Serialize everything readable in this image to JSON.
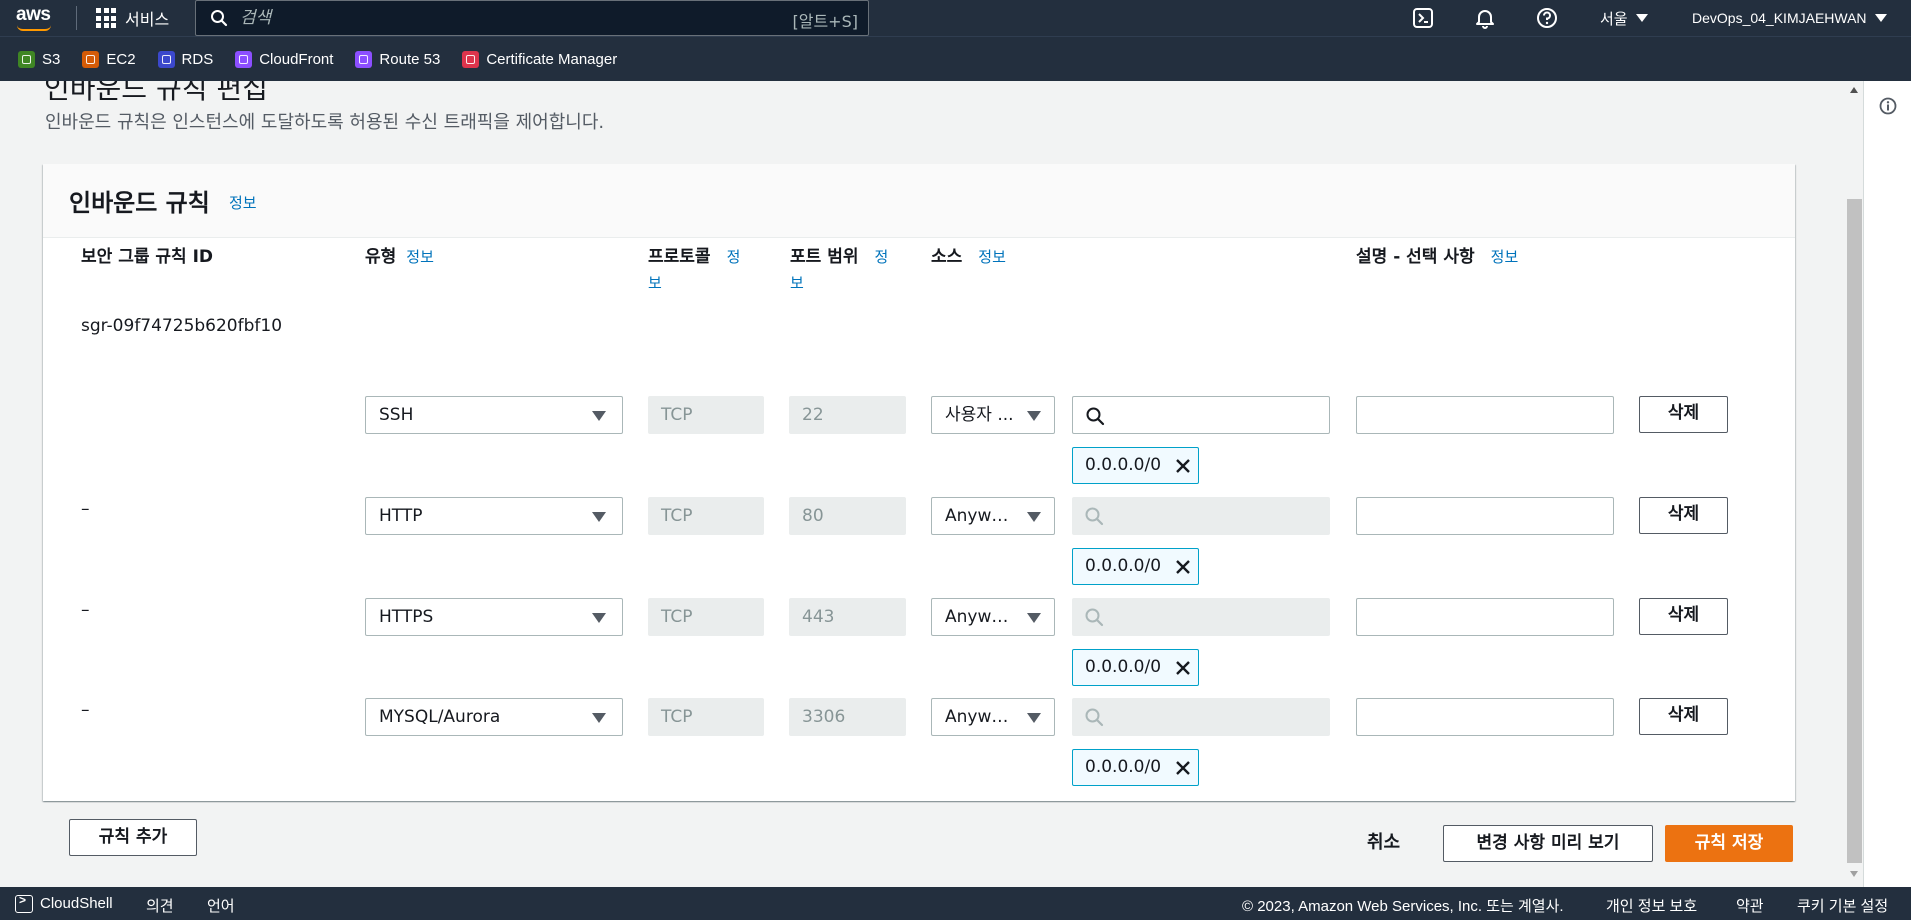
{
  "topnav": {
    "logo": "aws",
    "services_label": "서비스",
    "search_placeholder": "검색",
    "search_shortcut": "[알트+S]",
    "region": "서울",
    "account": "DevOps_04_KIMJAEHWAN",
    "icons": [
      "cloudshell-icon",
      "bell-icon",
      "help-icon"
    ]
  },
  "favorites": [
    {
      "label": "S3",
      "color": "#3f8624"
    },
    {
      "label": "EC2",
      "color": "#d45b07"
    },
    {
      "label": "RDS",
      "color": "#3b48cc"
    },
    {
      "label": "CloudFront",
      "color": "#8c4fff"
    },
    {
      "label": "Route 53",
      "color": "#8c4fff"
    },
    {
      "label": "Certificate Manager",
      "color": "#dd344c"
    }
  ],
  "page": {
    "clipped_title": "인바운드 규칙 편집",
    "description": "인바운드 규칙은 인스턴스에 도달하도록 허용된 수신 트래픽을 제어합니다."
  },
  "panel": {
    "title": "인바운드 규칙",
    "info": "정보",
    "columns": {
      "rule_id": "보안 그룹 규칙 ID",
      "type": "유형",
      "protocol_1": "프로토콜",
      "protocol_2": "보",
      "protocol_info": "정",
      "port_1": "포트 범위",
      "port_2": "보",
      "port_info": "정",
      "source": "소스",
      "description": "설명 - 선택 사항",
      "info": "정보"
    },
    "rules": [
      {
        "id": "sgr-09f74725b620fbf10",
        "type": "SSH",
        "protocol": "TCP",
        "port": "22",
        "source": "사용자 ...",
        "cidr": "0.0.0.0/0"
      },
      {
        "id": "–",
        "type": "HTTP",
        "protocol": "TCP",
        "port": "80",
        "source": "Anywh...",
        "cidr": "0.0.0.0/0"
      },
      {
        "id": "–",
        "type": "HTTPS",
        "protocol": "TCP",
        "port": "443",
        "source": "Anywh...",
        "cidr": "0.0.0.0/0"
      },
      {
        "id": "–",
        "type": "MYSQL/Aurora",
        "protocol": "TCP",
        "port": "3306",
        "source": "Anywh...",
        "cidr": "0.0.0.0/0"
      }
    ],
    "delete_label": "삭제",
    "add_rule_label": "규칙 추가"
  },
  "actions": {
    "cancel": "취소",
    "preview": "변경 사항 미리 보기",
    "save": "규칙 저장"
  },
  "footer": {
    "cloudshell": "CloudShell",
    "feedback": "의견",
    "language": "언어",
    "copyright": "© 2023, Amazon Web Services, Inc. 또는 계열사.",
    "privacy": "개인 정보 보호",
    "terms": "약관",
    "cookies": "쿠키 기본 설정"
  }
}
